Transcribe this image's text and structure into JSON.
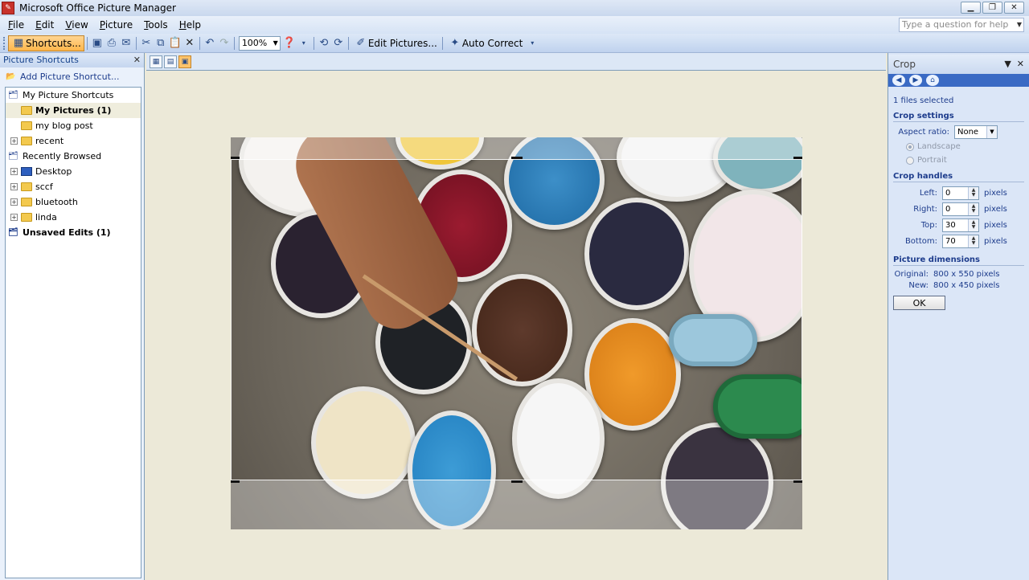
{
  "window": {
    "title": "Microsoft Office Picture Manager"
  },
  "menubar": {
    "items": [
      "File",
      "Edit",
      "View",
      "Picture",
      "Tools",
      "Help"
    ],
    "help_placeholder": "Type a question for help"
  },
  "toolbar": {
    "shortcuts_label": "Shortcuts...",
    "zoom_value": "100%",
    "edit_pictures_label": "Edit Pictures...",
    "auto_correct_label": "Auto Correct"
  },
  "left_pane": {
    "title": "Picture Shortcuts",
    "add_shortcut": "Add Picture Shortcut...",
    "tree": {
      "my_shortcuts": "My Picture Shortcuts",
      "my_pictures": "My Pictures (1)",
      "blog_post": "my blog post",
      "recent": "recent",
      "recently_browsed": "Recently Browsed",
      "desktop": "Desktop",
      "sccf": "sccf",
      "bluetooth": "bluetooth",
      "linda": "linda",
      "unsaved": "Unsaved Edits (1)"
    }
  },
  "crop_pane": {
    "title": "Crop",
    "files_selected": "1 files selected",
    "crop_settings": "Crop settings",
    "aspect_ratio_label": "Aspect ratio:",
    "aspect_ratio_value": "None",
    "landscape": "Landscape",
    "portrait": "Portrait",
    "crop_handles": "Crop handles",
    "left_label": "Left:",
    "left_value": "0",
    "right_label": "Right:",
    "right_value": "0",
    "top_label": "Top:",
    "top_value": "30",
    "bottom_label": "Bottom:",
    "bottom_value": "70",
    "unit": "pixels",
    "picture_dimensions": "Picture dimensions",
    "original_label": "Original:",
    "original_value": "800 x 550 pixels",
    "new_label": "New:",
    "new_value": "800 x 450 pixels",
    "ok_label": "OK"
  }
}
